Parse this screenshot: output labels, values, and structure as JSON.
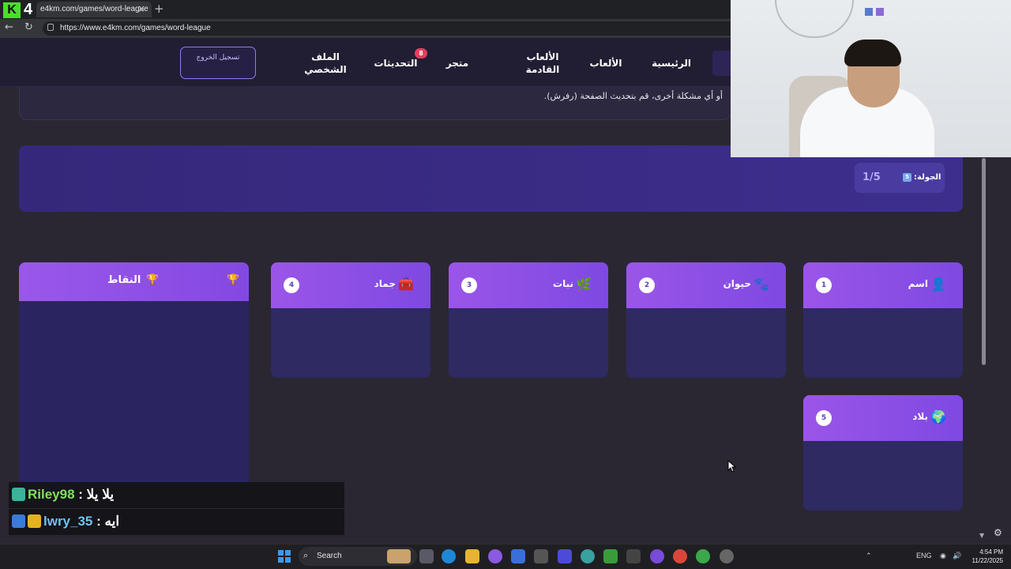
{
  "browser": {
    "tab_title": "e4km.com/games/word-league",
    "tab_close": "×",
    "new_tab": "+",
    "url": "https://www.e4km.com/games/word-league",
    "back": "←",
    "reload": "↻"
  },
  "overlay": {
    "k_logo": "K",
    "k_number": "4"
  },
  "header": {
    "nav": [
      {
        "label": "الرئيسية"
      },
      {
        "label": "الألعاب"
      },
      {
        "label": "الألعاب القادمة"
      },
      {
        "label": "متجر"
      },
      {
        "label": "التحديثات",
        "badge": "8"
      },
      {
        "label": "الملف الشخصي"
      }
    ],
    "logout_label": "تسجيل الخروج"
  },
  "notice": {
    "text": "أو أي مشكلة أخرى، قم بتحديث الصفحة (رفرش)."
  },
  "round": {
    "label": "الجولة:",
    "value": "1/5",
    "icon_text": "5"
  },
  "categories": [
    {
      "number": "1",
      "title": "اسم",
      "icon": "person-icon",
      "glyph": "👤"
    },
    {
      "number": "2",
      "title": "حيوان",
      "icon": "paw-icon",
      "glyph": "🐾"
    },
    {
      "number": "3",
      "title": "نبات",
      "icon": "plant-icon",
      "glyph": "🌿"
    },
    {
      "number": "4",
      "title": "جماد",
      "icon": "box-icon",
      "glyph": "🧰"
    },
    {
      "number": "5",
      "title": "بلاد",
      "icon": "globe-icon",
      "glyph": "🌍"
    }
  ],
  "points": {
    "title": "النقاط",
    "trophy": "🏆"
  },
  "chat": [
    {
      "user": "Riley98",
      "message": "يلا يلا",
      "separator": " : "
    },
    {
      "user": "lwry_35",
      "message": "ايه",
      "separator": " : "
    }
  ],
  "taskbar": {
    "search_label": "Search",
    "search_glyph": "⌕",
    "lang": "ENG",
    "time": "4:54 PM",
    "date": "11/22/2025"
  },
  "colors": {
    "accent": "#8f56e6",
    "card_body": "#2f2a62",
    "header_bg": "#211e33",
    "badge": "#e73c5a"
  }
}
